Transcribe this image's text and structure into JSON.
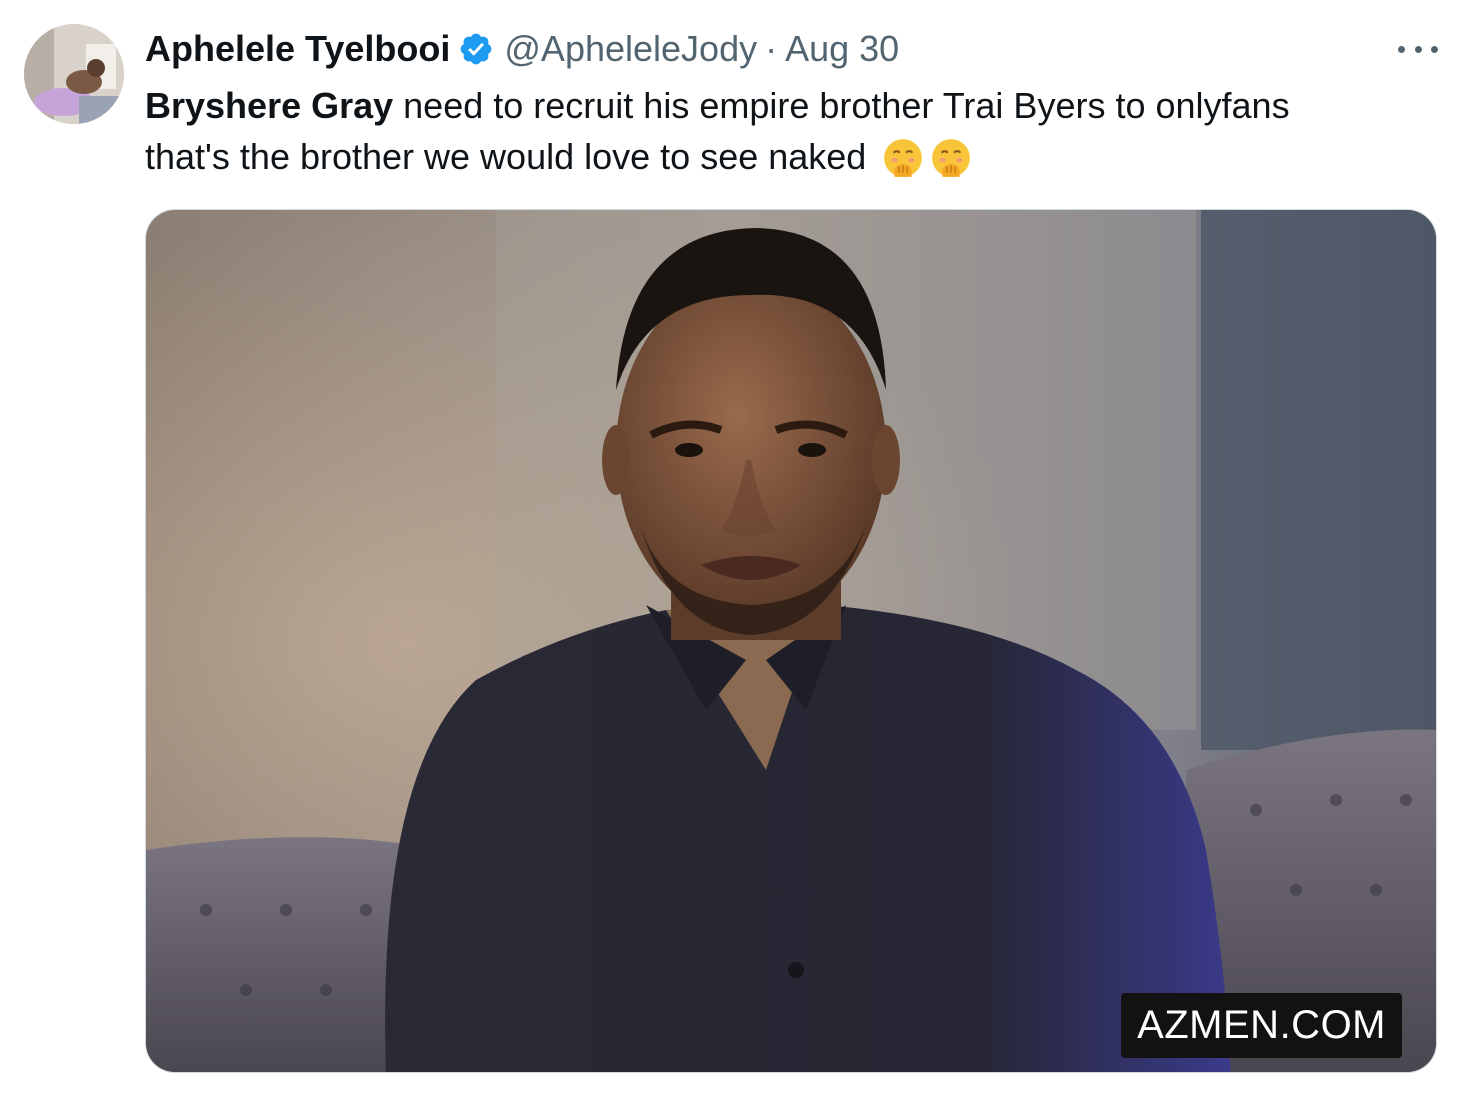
{
  "tweet": {
    "author": {
      "display_name": "Aphelele Tyelbooi",
      "handle": "@ApheleleJody",
      "verified_icon": "verified-badge-icon",
      "avatar_icon": "avatar-photo"
    },
    "separator": "·",
    "date": "Aug 30",
    "more_icon": "more-options-icon",
    "text": {
      "mention": "Bryshere Gray",
      "line1_rest": " need to recruit his empire brother Trai Byers to onlyfans",
      "line2": "that's the brother we would love to see naked",
      "emoji_icon": "face-with-hand-over-mouth-icon",
      "emoji_count": 2
    },
    "media": {
      "description_icon": "photo-man-dark-shirt",
      "watermark": "AZMEN.COM"
    }
  },
  "colors": {
    "text_primary": "#0f1419",
    "text_secondary": "#536471",
    "verified_blue": "#1d9bf0",
    "border": "#cfd9de"
  }
}
